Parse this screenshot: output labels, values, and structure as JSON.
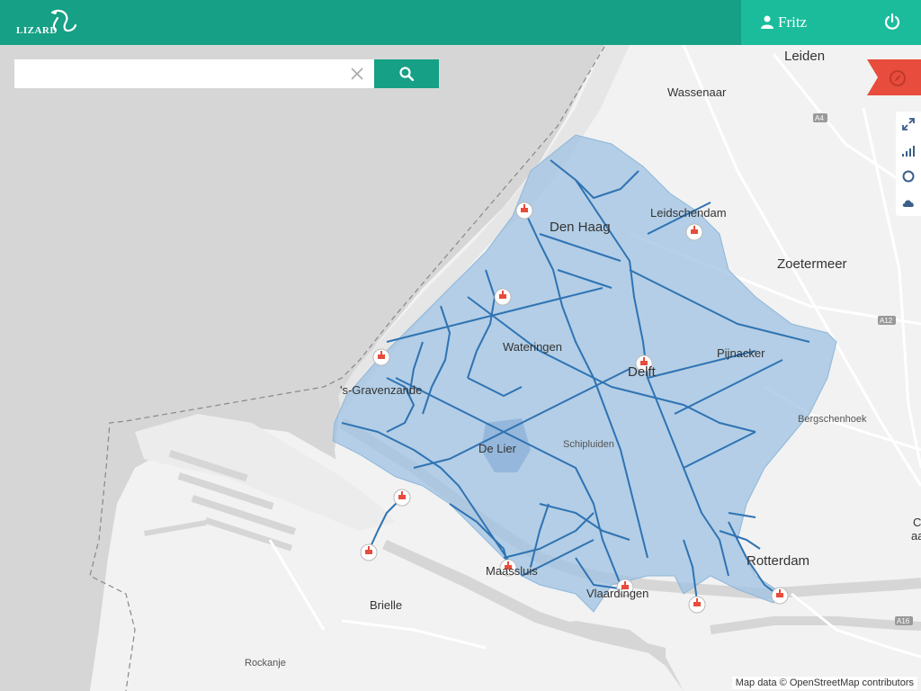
{
  "app": {
    "logo_text": "LIZARD"
  },
  "header": {
    "user_name": "Fritz"
  },
  "search": {
    "placeholder": "",
    "value": ""
  },
  "map": {
    "attribution": "Map data © OpenStreetMap contributors",
    "labels": {
      "leiden": "Leiden",
      "wassenaar": "Wassenaar",
      "den_haag": "Den Haag",
      "leidschendam": "Leidschendam",
      "zoetermeer": "Zoetermeer",
      "wateringen": "Wateringen",
      "delft": "Delft",
      "pijnacker": "Pijnacker",
      "gravenzande": "'s-Gravenzande",
      "bergschenhoek": "Bergschenhoek",
      "de_lier": "De Lier",
      "schipluiden": "Schipluiden",
      "rotterdam": "Rotterdam",
      "maassluis": "Maassluis",
      "vlaardingen": "Vlaardingen",
      "brielle": "Brielle",
      "rockanje": "Rockanje",
      "capelle_partial": "C",
      "capelle_partial2": "aa",
      "road_a4": "A4",
      "road_a12": "A12",
      "road_a16": "A16"
    },
    "colors": {
      "sea": "#d6d6d6",
      "land": "#f2f2f2",
      "area": "#9ec2e2",
      "network": "#2f73b3",
      "accent": "#16a085",
      "marker": "#e74c3c"
    }
  },
  "icons": {
    "logo": "lizard-logo-icon",
    "user": "user-icon",
    "power": "power-icon",
    "clear": "close-icon",
    "search": "search-icon",
    "compass": "compass-icon",
    "fullscreen": "expand-icon",
    "signal": "signal-bars-icon",
    "circle": "circle-icon",
    "cloud": "cloud-icon",
    "station": "pumping-station-icon"
  }
}
